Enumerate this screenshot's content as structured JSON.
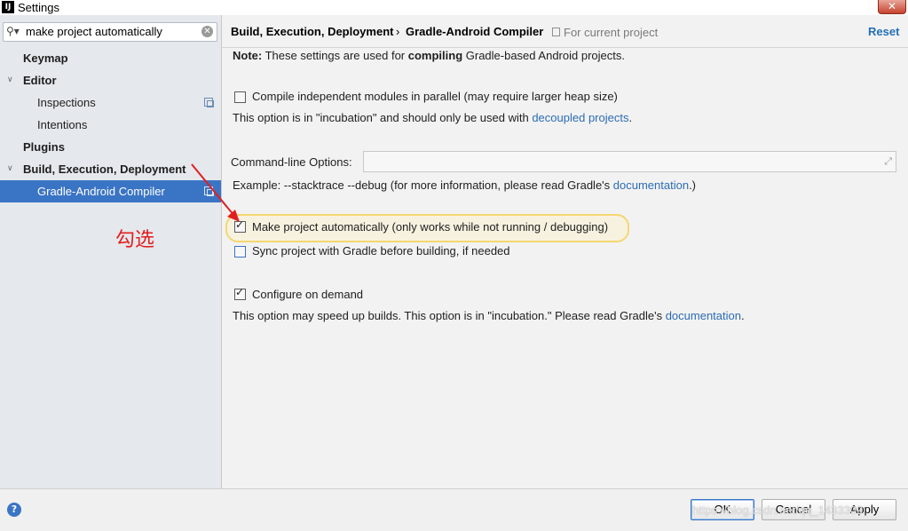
{
  "window": {
    "app_icon_text": "IJ",
    "title": "Settings",
    "close_icon": "close-icon"
  },
  "sidebar": {
    "search": {
      "value": "make project automatically",
      "icon": "search-icon"
    },
    "items": [
      {
        "label": "Keymap"
      },
      {
        "label": "Editor"
      },
      {
        "label": "Inspections"
      },
      {
        "label": "Intentions"
      },
      {
        "label": "Plugins"
      },
      {
        "label": "Build, Execution, Deployment"
      },
      {
        "label": "Gradle-Android Compiler",
        "selected": true
      }
    ]
  },
  "annotation": {
    "text": "勾选",
    "color": "#e02020"
  },
  "header": {
    "breadcrumb_parent": "Build, Execution, Deployment",
    "breadcrumb_separator": "›",
    "breadcrumb_current": "Gradle-Android Compiler",
    "scope": "For current project",
    "reset_label": "Reset"
  },
  "note": {
    "label": "Note:",
    "pre": " These settings are used for ",
    "bold": "compiling",
    "post": " Gradle-based Android projects."
  },
  "options": {
    "parallel": {
      "label": "Compile independent modules in parallel (may require larger heap size)",
      "checked": false,
      "hint_pre": "This option is in \"incubation\" and should only be used with ",
      "hint_link": "decoupled projects",
      "hint_post": "."
    },
    "command_line": {
      "label": "Command-line Options:",
      "value": "",
      "example_pre": "Example: --stacktrace --debug (for more information, please read Gradle's ",
      "example_link": "documentation",
      "example_post": ".)"
    },
    "make_auto": {
      "label": "Make project automatically (only works while not running / debugging)",
      "checked": true
    },
    "sync": {
      "label": "Sync project with Gradle before building, if needed",
      "checked": false
    },
    "configure": {
      "label": "Configure on demand",
      "checked": true,
      "hint_pre": "This option may speed up builds. This option is in \"incubation.\" Please read Gradle's ",
      "hint_link": "documentation",
      "hint_post": "."
    }
  },
  "footer": {
    "help": "?",
    "ok": "OK",
    "cancel": "Cancel",
    "apply": "Apply",
    "watermark": "https://blog.csdn.net/qq_1433309"
  },
  "colors": {
    "accent": "#3a74c5",
    "link": "#2c6cb6",
    "highlight_border": "#f4d770"
  }
}
